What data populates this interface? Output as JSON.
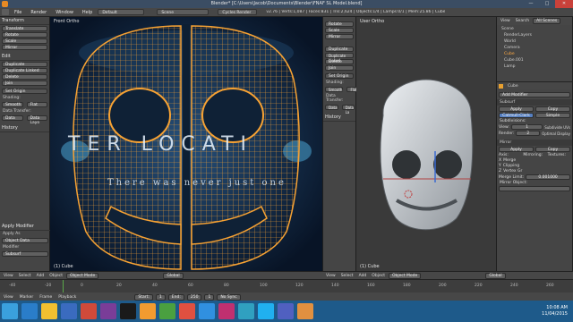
{
  "window": {
    "title": "Blender* [C:\\Users\\Jacob\\Documents\\Blender\\FNAF SL Model.blend]",
    "minimize": "—",
    "maximize": "□",
    "close": "✕"
  },
  "info_header": {
    "menus": [
      "File",
      "Render",
      "Window",
      "Help"
    ],
    "layout": "Default",
    "scene": "Scene",
    "engine": "Cycles Render",
    "stats": "v2.76 | Verts:1,087 | Faces:831 | Tris:2,624 | Objects:1/4 | Lamps:0/1 | Mem:25.86 | Cube"
  },
  "left_shelf": {
    "transform_header": "Transform",
    "transform_buttons": [
      "Translate",
      "Rotate",
      "Scale",
      "Mirror"
    ],
    "edit_header": "Edit",
    "edit_buttons": [
      "Duplicate",
      "Duplicate Linked",
      "Delete",
      "Join"
    ],
    "set_origin": "Set Origin",
    "shading_label": "Shading:",
    "shading_buttons": [
      "Smooth",
      "Flat"
    ],
    "data_transfer": "Data Transfer:",
    "data_buttons": [
      "Data",
      "Data Layo"
    ],
    "history_header": "History",
    "apply_modifier_header": "Apply Modifier",
    "apply_as": "Apply As",
    "apply_as_value": "Object Data",
    "modifier_label": "Modifier",
    "modifier_value": "Subsurf"
  },
  "viewport_left": {
    "title": "Front Ortho",
    "footer": "(1) Cube",
    "overlay_text_1": "TER   LOCATI",
    "overlay_text_2": "There was never just one"
  },
  "mid_shelf": {
    "buttons": [
      "Rotate",
      "Scale",
      "Mirror"
    ],
    "edit_buttons": [
      "Duplicate",
      "Duplicate Linked",
      "Delete",
      "Join"
    ],
    "set_origin": "Set Origin",
    "shading_label": "Shading:",
    "shading_buttons": [
      "Smooth",
      "Flat"
    ],
    "data_transfer": "Data Transfer:",
    "data_buttons": [
      "Data",
      "Data La"
    ],
    "history_header": "History"
  },
  "viewport_right": {
    "title": "User Ortho",
    "footer": "(1) Cube"
  },
  "outliner": {
    "header_view": "View",
    "header_search": "Search",
    "header_scenes": "All Scenes",
    "items": [
      "Scene",
      "RenderLayers",
      "World",
      "Camera",
      "Cube",
      "Cube.001",
      "Lamp"
    ]
  },
  "properties": {
    "object_name": "Cube",
    "add_modifier": "Add Modifier",
    "modifier_name": "Subsurf",
    "apply_label": "Apply",
    "copy_label": "Copy",
    "subdiv_tabs": [
      "Catmull-Clark",
      "Simple"
    ],
    "subdivisions_label": "Subdivisions:",
    "view_label": "View:",
    "view_value": "1",
    "render_label": "Render:",
    "render_value": "2",
    "options_label": "Options:",
    "subdivide_uvs": "Subdivide UVs",
    "optimal_display": "Optimal Display",
    "mirror_modifier": "Mirror",
    "apply2": "Apply",
    "copy2": "Copy",
    "axis_label": "Axis:",
    "mirroring_label": "Mirroring:",
    "textures_label": "Textures:",
    "axes": [
      "X",
      "Y",
      "Z"
    ],
    "merge_label": "Merge",
    "clipping_label": "Clipping",
    "vertex_groups": "Vertex Gr",
    "merge_limit_label": "Merge Limit:",
    "merge_limit_value": "0.001000",
    "mirror_object_label": "Mirror Object:"
  },
  "view_header_left": {
    "items": [
      "View",
      "Select",
      "Add",
      "Object"
    ],
    "mode": "Object Mode",
    "pivot": "Global"
  },
  "view_header_right": {
    "items": [
      "View",
      "Select",
      "Add",
      "Object"
    ],
    "mode": "Object Mode",
    "pivot": "Global"
  },
  "timeline": {
    "menus": [
      "View",
      "Marker",
      "Frame",
      "Playback"
    ],
    "start_label": "Start:",
    "start_value": "1",
    "end_label": "End:",
    "end_value": "250",
    "current_value": "1",
    "sync": "No Sync",
    "ticks": [
      "-40",
      "-20",
      "0",
      "20",
      "40",
      "60",
      "80",
      "100",
      "120",
      "140",
      "160",
      "180",
      "200",
      "220",
      "240",
      "260"
    ]
  },
  "taskbar": {
    "time": "10:08 AM",
    "date": "11/04/2015",
    "colors": [
      "#3aa0dd",
      "#2a7dc9",
      "#f0c030",
      "#3a6bbf",
      "#d04a3a",
      "#7a3d98",
      "#1a1a1a",
      "#f29b30",
      "#4aa040",
      "#e05040",
      "#3090e0",
      "#c03070",
      "#30a0c0",
      "#20b0f0",
      "#5060c0",
      "#e09040"
    ]
  },
  "accent_color": "#f7a233"
}
